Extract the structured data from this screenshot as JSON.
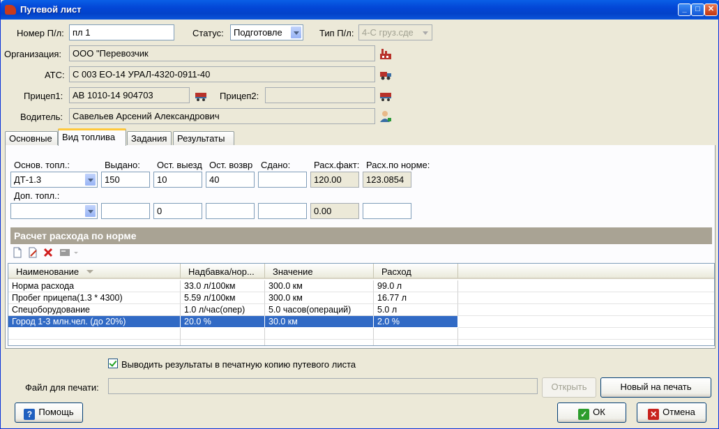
{
  "window": {
    "title": "Путевой лист"
  },
  "header": {
    "number_label": "Номер П/л:",
    "number_value": "пл 1",
    "status_label": "Статус:",
    "status_value": "Подготовле",
    "type_label": "Тип П/л:",
    "type_value": "4-С груз.сде",
    "org_label": "Организация:",
    "org_value": "ООО \"Перевозчик",
    "ats_label": "АТС:",
    "ats_value": "С 003 ЕО-14 УРАЛ-4320-0911-40",
    "trailer1_label": "Прицеп1:",
    "trailer1_value": "АВ 1010-14 904703",
    "trailer2_label": "Прицеп2:",
    "trailer2_value": "",
    "driver_label": "Водитель:",
    "driver_value": "Савельев Арсений Александрович"
  },
  "tabs": [
    {
      "label": "Основные"
    },
    {
      "label": "Вид топлива"
    },
    {
      "label": "Задания"
    },
    {
      "label": "Результаты"
    }
  ],
  "fuel": {
    "col_labels": {
      "main_fuel": "Основ. топл.:",
      "issued": "Выдано:",
      "rest_out": "Ост. выезд",
      "rest_return": "Ост. возвр",
      "handed": "Сдано:",
      "fact": "Расх.факт:",
      "norm": "Расх.по норме:"
    },
    "extra_label": "Доп. топл.:",
    "main_row": {
      "fuel": "ДТ-1.3",
      "issued": "150",
      "rest_out": "10",
      "rest_return": "40",
      "handed": "",
      "fact": "120.00",
      "norm": "123.0854"
    },
    "extra_row": {
      "fuel": "",
      "issued": "",
      "rest_out": "0",
      "rest_return": "",
      "handed": "",
      "fact": "0.00",
      "norm": ""
    }
  },
  "norm_section": {
    "title": "Расчет расхода по норме",
    "columns": [
      "Наименование",
      "Надбавка/нор...",
      "Значение",
      "Расход"
    ],
    "rows": [
      [
        "Норма расхода",
        "33.0 л/100км",
        "300.0 км",
        "99.0 л"
      ],
      [
        "Пробег прицепа(1.3 * 4300)",
        "5.59 л/100км",
        "300.0 км",
        "16.77 л"
      ],
      [
        "Спецоборудование",
        "1.0 л/час(опер)",
        "5.0 часов(операций)",
        "5.0 л"
      ],
      [
        "Город 1-3 млн.чел. (до 20%)",
        "20.0 %",
        "30.0 км",
        "2.0 %"
      ]
    ],
    "selected_row": 3
  },
  "footer": {
    "print_checkbox_label": "Выводить результаты в печатную копию путевого листа",
    "print_checked": true,
    "file_label": "Файл для печати:",
    "file_value": "",
    "open_label": "Открыть",
    "new_print_label": "Новый на печать",
    "help_label": "Помощь",
    "ok_label": "ОК",
    "cancel_label": "Отмена"
  },
  "icons": {
    "org": "factory-icon",
    "ats": "truck-icon",
    "trailer": "trailer-icon",
    "driver": "person-icon",
    "new": "new-document-icon",
    "edit": "edit-document-icon",
    "delete": "delete-icon",
    "calc": "calculator-icon"
  },
  "colors": {
    "title_bar": "#0A5FE6",
    "section_header": "#A9A394",
    "selection": "#316AC5",
    "active_tab_accent": "#FFC83C"
  }
}
